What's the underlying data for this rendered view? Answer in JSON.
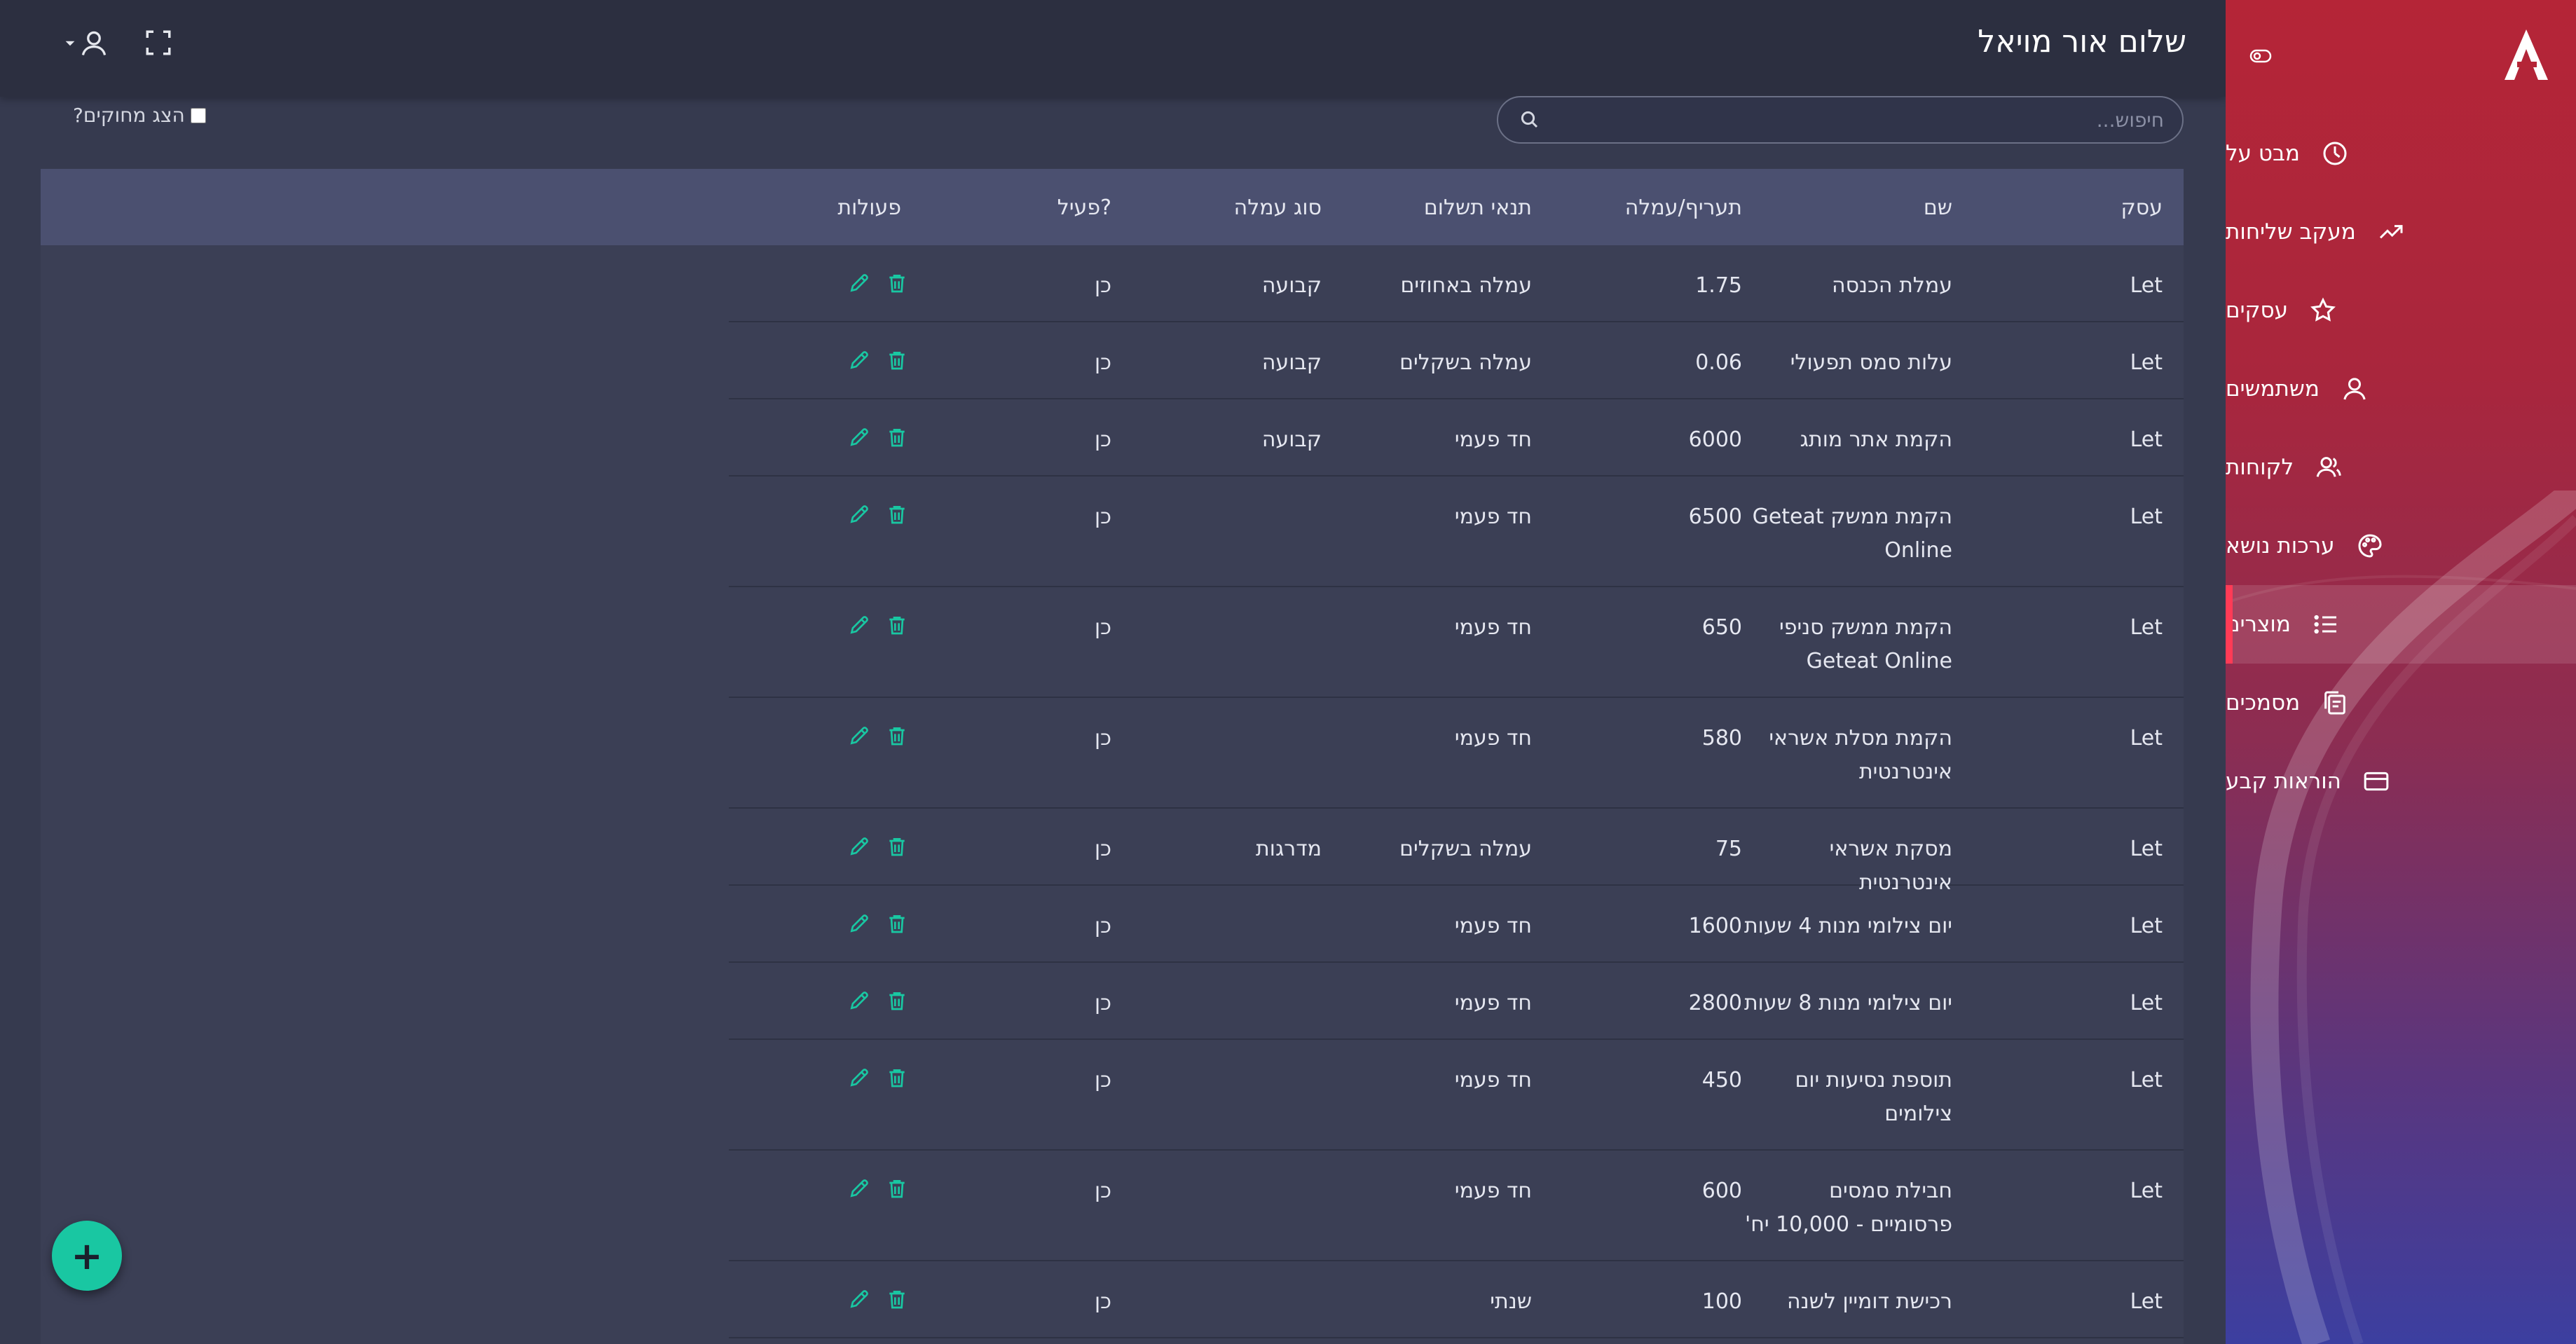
{
  "topbar": {
    "greeting": "שלום אור מויאל",
    "user_icon": "user-icon",
    "fullscreen_icon": "fullscreen-icon"
  },
  "sidebar": {
    "logo": "A",
    "items": [
      {
        "label": "מבט על",
        "icon": "dashboard-icon",
        "active": false
      },
      {
        "label": "מעקב שליחות",
        "icon": "trend-icon",
        "active": false
      },
      {
        "label": "עסקים",
        "icon": "star-icon",
        "active": false
      },
      {
        "label": "משתמשים",
        "icon": "user-icon",
        "active": false
      },
      {
        "label": "לקוחות",
        "icon": "users-icon",
        "active": false
      },
      {
        "label": "ערכות נושא",
        "icon": "palette-icon",
        "active": false
      },
      {
        "label": "מוצרים",
        "icon": "list-icon",
        "active": true
      },
      {
        "label": "מסמכים",
        "icon": "documents-icon",
        "active": false
      },
      {
        "label": "הוראות קבע",
        "icon": "credit-card-icon",
        "active": false
      }
    ]
  },
  "search": {
    "placeholder": "חיפוש..."
  },
  "filters": {
    "show_deleted_label": "הצג מחוקים?",
    "show_deleted_checked": false
  },
  "table": {
    "headers": {
      "business": "עסק",
      "name": "שם",
      "price": "תעריף/עמלה",
      "terms": "תנאי תשלום",
      "type": "סוג עמלה",
      "active": "פעיל?",
      "actions": "פעולות"
    },
    "rows": [
      {
        "business": "Let",
        "name": "עמלת הכנסה",
        "price": "1.75",
        "terms": "עמלה באחוזים",
        "type": "קבועה",
        "active": "כן"
      },
      {
        "business": "Let",
        "name": "עלות סמס תפעולי",
        "price": "0.06",
        "terms": "עמלה בשקלים",
        "type": "קבועה",
        "active": "כן"
      },
      {
        "business": "Let",
        "name": "הקמת אתר מותג",
        "price": "6000",
        "terms": "חד פעמי",
        "type": "קבועה",
        "active": "כן"
      },
      {
        "business": "Let",
        "name": "הקמת ממשק Geteat Online",
        "price": "6500",
        "terms": "חד פעמי",
        "type": "",
        "active": "כן"
      },
      {
        "business": "Let",
        "name": "הקמת ממשק סניפי Geteat Online",
        "price": "650",
        "terms": "חד פעמי",
        "type": "",
        "active": "כן"
      },
      {
        "business": "Let",
        "name": "הקמת מסלת אשראי אינטרנטית",
        "price": "580",
        "terms": "חד פעמי",
        "type": "",
        "active": "כן"
      },
      {
        "business": "Let",
        "name": "מסקת אשראי אינטרנטית",
        "price": "75",
        "terms": "עמלה בשקלים",
        "type": "מדרגות",
        "active": "כן"
      },
      {
        "business": "Let",
        "name": "יום צילומי מנות 4 שעות",
        "price": "1600",
        "terms": "חד פעמי",
        "type": "",
        "active": "כן"
      },
      {
        "business": "Let",
        "name": "יום צילומי מנות 8 שעות",
        "price": "2800",
        "terms": "חד פעמי",
        "type": "",
        "active": "כן"
      },
      {
        "business": "Let",
        "name": "תוספת נסיעות יום צילומים",
        "price": "450",
        "terms": "חד פעמי",
        "type": "",
        "active": "כן"
      },
      {
        "business": "Let",
        "name": "חבילת סמסים פרסומיים - 10,000 יח'",
        "price": "600",
        "terms": "חד פעמי",
        "type": "",
        "active": "כן"
      },
      {
        "business": "Let",
        "name": "רכישת דומיין לשנה",
        "price": "100",
        "terms": "שנתי",
        "type": "",
        "active": "כן"
      }
    ]
  },
  "fab": {
    "label": "+"
  },
  "colors": {
    "accent": "#19c7a2",
    "sidebar_active": "#ff3b56",
    "header_bg": "#4b5070",
    "table_bg": "#3b3f55"
  }
}
